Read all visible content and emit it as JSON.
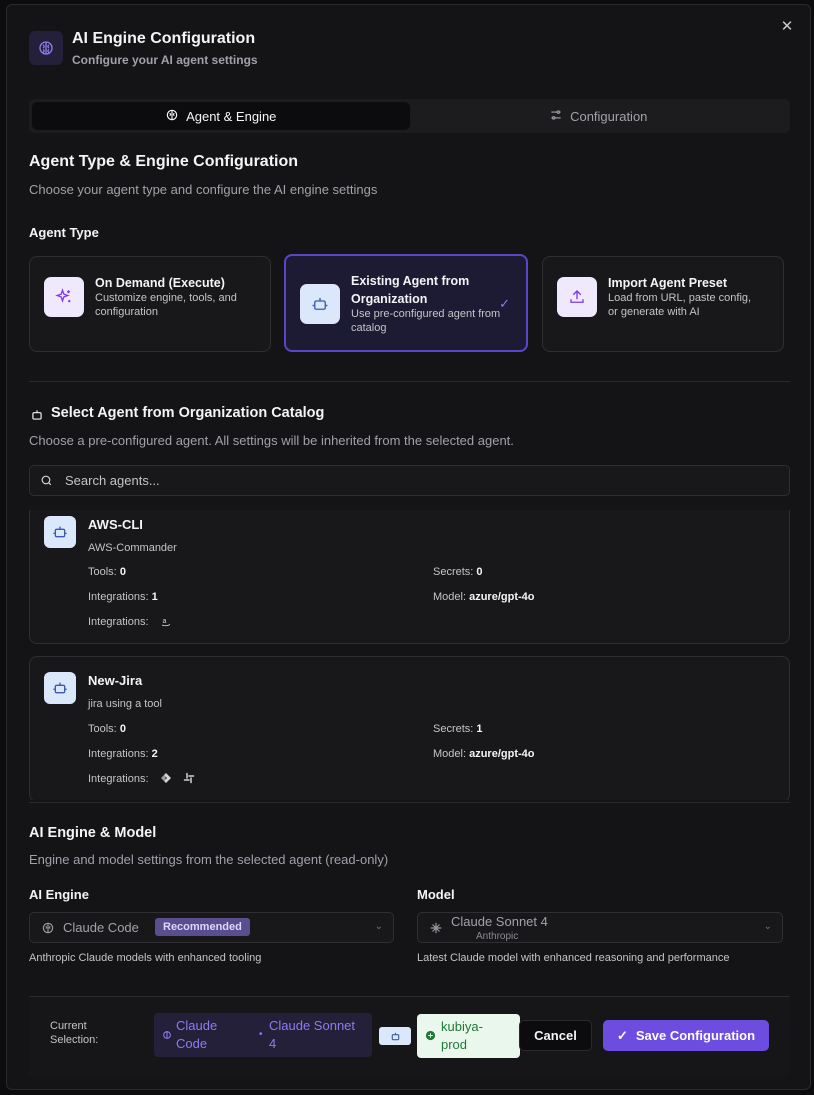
{
  "header": {
    "title": "AI Engine Configuration",
    "subtitle": "Configure your AI agent settings",
    "close_icon": "x-icon"
  },
  "tabs": [
    {
      "label": "Agent & Engine",
      "icon": "brain-icon",
      "active": true
    },
    {
      "label": "Configuration",
      "icon": "sliders-icon",
      "active": false
    }
  ],
  "agent_type_section": {
    "title": "Agent Type & Engine Configuration",
    "subtitle": "Choose your agent type and configure the AI engine settings",
    "label": "Agent Type",
    "options": [
      {
        "title": "On Demand (Execute)",
        "description": "Customize engine, tools, and configuration",
        "icon": "sparkles-icon",
        "selected": false
      },
      {
        "title": "Existing Agent from Organization",
        "description": "Use pre-configured agent from catalog",
        "icon": "bot-icon",
        "selected": true
      },
      {
        "title": "Import Agent Preset",
        "description": "Load from URL, paste config, or generate with AI",
        "icon": "upload-icon",
        "selected": false
      }
    ]
  },
  "catalog": {
    "title": "Select Agent from Organization Catalog",
    "subtitle": "Choose a pre-configured agent. All settings will be inherited from the selected agent.",
    "search_placeholder": "Search agents...",
    "agents": [
      {
        "name": "AWS-CLI",
        "description": "AWS-Commander",
        "tools_label": "Tools:",
        "tools": "0",
        "secrets_label": "Secrets:",
        "secrets": "0",
        "integrations_label": "Integrations:",
        "integrations": "1",
        "model_label": "Model:",
        "model": "azure/gpt-4o",
        "integration_icons_label": "Integrations:",
        "integration_icons": [
          "aws-icon"
        ]
      },
      {
        "name": "New-Jira",
        "description": "jira using a tool",
        "tools_label": "Tools:",
        "tools": "0",
        "secrets_label": "Secrets:",
        "secrets": "1",
        "integrations_label": "Integrations:",
        "integrations": "2",
        "model_label": "Model:",
        "model": "azure/gpt-4o",
        "integration_icons_label": "Integrations:",
        "integration_icons": [
          "jira-icon",
          "slack-icon"
        ]
      }
    ]
  },
  "engine_section": {
    "title": "AI Engine & Model",
    "subtitle": "Engine and model settings from the selected agent (read-only)",
    "engine_label": "AI Engine",
    "engine_value": "Claude Code",
    "engine_badge": "Recommended",
    "engine_help": "Anthropic Claude models with enhanced tooling",
    "model_label": "Model",
    "model_value": "Claude Sonnet 4",
    "model_provider": "Anthropic",
    "model_help": "Latest Claude model with enhanced reasoning and performance"
  },
  "footer": {
    "current_label_line1": "Current",
    "current_label_line2": "Selection:",
    "engine_pill_line1": "Claude",
    "engine_pill_line2": "Code",
    "model_pill_line1": "Claude Sonnet",
    "model_pill_line2": "4",
    "env_line1": "kubiya-",
    "env_line2": "prod",
    "cancel_label": "Cancel",
    "save_label": "Save Configuration"
  },
  "colors": {
    "accent": "#6d4ce0",
    "selected_border": "#5b45c9",
    "env_bg": "#eaf7ec",
    "env_text": "#1f7a36"
  }
}
